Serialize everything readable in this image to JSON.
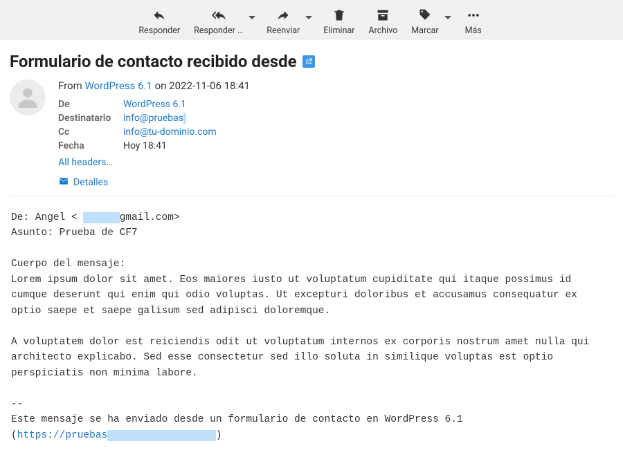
{
  "toolbar": {
    "reply": "Responder",
    "reply_all": "Responder …",
    "forward": "Reenviar",
    "delete": "Eliminar",
    "archive": "Archivo",
    "mark": "Marcar",
    "more": "Más"
  },
  "subject": "Formulario de contacto recibido desde",
  "from_line": {
    "prefix": "From ",
    "sender": "WordPress 6.1",
    "on": " on ",
    "date": "2022-11-06 18:41"
  },
  "headers": {
    "de_key": "De",
    "de_val": "WordPress 6.1",
    "dest_key": "Destinatario",
    "dest_val_prefix": "info@pruebas",
    "dest_val_redacted": "            ",
    "cc_key": "Cc",
    "cc_val": "info@tu-dominio.com",
    "fecha_key": "Fecha",
    "fecha_val": "Hoy 18:41",
    "all_headers": "All headers…"
  },
  "details_label": "Detalles",
  "body": {
    "line1a": "De: Angel < ",
    "line1_redact": "      ",
    "line1b": "gmail.com>",
    "line2": "Asunto: Prueba de CF7",
    "line3": "Cuerpo del mensaje:",
    "para1": "Lorem ipsum dolor sit amet. Eos maiores iusto ut voluptatum cupiditate qui itaque possimus id cumque deserunt qui enim qui odio voluptas. Ut excepturi doloribus et accusamus consequatur ex optio saepe et saepe galisum sed adipisci doloremque.",
    "para2": "A voluptatem dolor est reiciendis odit ut voluptatum internos ex corporis nostrum amet nulla qui architecto explicabo. Sed esse consectetur sed illo soluta in similique voluptas est optio perspiciatis non minima labore.",
    "sep": "--",
    "footer1": "Este mensaje se ha enviado desde un formulario de contacto en WordPress 6.1",
    "footer2_open": "(",
    "footer2_link": "https://pruebas",
    "footer2_redact": "                  ",
    "footer2_close": ")"
  }
}
